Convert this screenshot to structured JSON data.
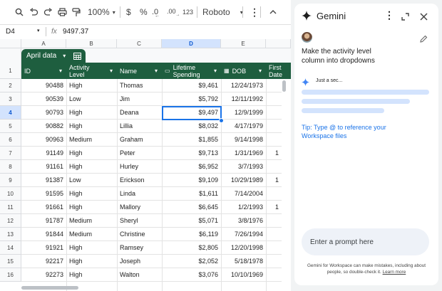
{
  "toolbar": {
    "zoom": "100%",
    "currency": "$",
    "percent": "%",
    "decimal_decrease": ".0",
    "format_123": "123",
    "font": "Roboto"
  },
  "formula_bar": {
    "name_box": "D4",
    "fx": "fx",
    "formula": "9497.37"
  },
  "columns": [
    "A",
    "B",
    "C",
    "D",
    "E"
  ],
  "selected_column": "D",
  "table": {
    "name": "April data",
    "headers": [
      "ID",
      "Activity Level",
      "Name",
      "Lifetime Spending",
      "DOB",
      "First Date"
    ],
    "rows": [
      {
        "n": "2",
        "id": "90488",
        "level": "High",
        "name": "Thomas",
        "spend": "$9,461",
        "dob": "12/24/1973",
        "extra": ""
      },
      {
        "n": "3",
        "id": "90539",
        "level": "Low",
        "name": "Jim",
        "spend": "$5,792",
        "dob": "12/11/1992",
        "extra": ""
      },
      {
        "n": "4",
        "id": "90793",
        "level": "High",
        "name": "Deana",
        "spend": "$9,497",
        "dob": "12/9/1999",
        "extra": ""
      },
      {
        "n": "5",
        "id": "90882",
        "level": "High",
        "name": "Lillia",
        "spend": "$8,032",
        "dob": "4/17/1979",
        "extra": ""
      },
      {
        "n": "6",
        "id": "90963",
        "level": "Medium",
        "name": "Graham",
        "spend": "$1,855",
        "dob": "9/14/1998",
        "extra": ""
      },
      {
        "n": "7",
        "id": "91149",
        "level": "High",
        "name": "Peter",
        "spend": "$9,713",
        "dob": "1/31/1969",
        "extra": "1"
      },
      {
        "n": "8",
        "id": "91161",
        "level": "High",
        "name": "Hurley",
        "spend": "$6,952",
        "dob": "3/7/1993",
        "extra": ""
      },
      {
        "n": "9",
        "id": "91387",
        "level": "Low",
        "name": "Erickson",
        "spend": "$9,109",
        "dob": "10/29/1989",
        "extra": "1"
      },
      {
        "n": "10",
        "id": "91595",
        "level": "High",
        "name": "Linda",
        "spend": "$1,611",
        "dob": "7/14/2004",
        "extra": ""
      },
      {
        "n": "11",
        "id": "91661",
        "level": "High",
        "name": "Mallory",
        "spend": "$6,645",
        "dob": "1/2/1993",
        "extra": "1"
      },
      {
        "n": "12",
        "id": "91787",
        "level": "Medium",
        "name": "Sheryl",
        "spend": "$5,071",
        "dob": "3/8/1976",
        "extra": ""
      },
      {
        "n": "13",
        "id": "91844",
        "level": "Medium",
        "name": "Christine",
        "spend": "$6,119",
        "dob": "7/26/1994",
        "extra": ""
      },
      {
        "n": "14",
        "id": "91921",
        "level": "High",
        "name": "Ramsey",
        "spend": "$2,805",
        "dob": "12/20/1998",
        "extra": ""
      },
      {
        "n": "15",
        "id": "92217",
        "level": "High",
        "name": "Joseph",
        "spend": "$2,052",
        "dob": "5/18/1978",
        "extra": ""
      },
      {
        "n": "16",
        "id": "92273",
        "level": "High",
        "name": "Walton",
        "spend": "$3,076",
        "dob": "10/10/1969",
        "extra": ""
      }
    ]
  },
  "gemini": {
    "title": "Gemini",
    "user_prompt": "Make the activity level column into dropdowns",
    "status": "Just a sec...",
    "tip": "Tip: Type @ to reference your Workspace files",
    "input_placeholder": "Enter a prompt here",
    "disclaimer": "Gemini for Workspace can make mistakes, including about people, so double-check it.",
    "learn_more": "Learn more",
    "accent": "#1a73e8"
  },
  "colors": {
    "table_header": "#1e5e3f",
    "selection": "#1a73e8"
  }
}
